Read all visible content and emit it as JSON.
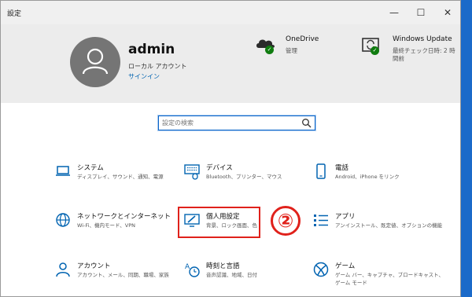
{
  "window": {
    "title": "設定"
  },
  "controls": {
    "minimize": "—",
    "maximize": "☐",
    "close": "✕"
  },
  "profile": {
    "name": "admin",
    "account_type": "ローカル アカウント",
    "sign_in": "サインイン"
  },
  "onedrive": {
    "name": "OneDrive",
    "status": "管理"
  },
  "windows_update": {
    "name": "Windows Update",
    "status_line1": "最終チェック日時: 2 時",
    "status_line2": "間前"
  },
  "search": {
    "placeholder": "設定の検索"
  },
  "tiles": [
    {
      "icon": "laptop-icon",
      "title": "システム",
      "desc": "ディスプレイ、サウンド、通知、電源"
    },
    {
      "icon": "keyboard-icon",
      "title": "デバイス",
      "desc": "Bluetooth、プリンター、マウス"
    },
    {
      "icon": "phone-icon",
      "title": "電話",
      "desc": "Android、iPhone をリンク"
    },
    {
      "icon": "globe-icon",
      "title": "ネットワークとインターネット",
      "desc": "Wi-Fi、機内モード、VPN"
    },
    {
      "icon": "personalization-icon",
      "title": "個人用設定",
      "desc": "背景、ロック画面、色"
    },
    {
      "icon": "apps-icon",
      "title": "アプリ",
      "desc": "アンインストール、既定値、オプションの機能"
    },
    {
      "icon": "person-icon",
      "title": "アカウント",
      "desc": "アカウント、メール、同期、職場、家族"
    },
    {
      "icon": "time-language-icon",
      "title": "時刻と言語",
      "desc": "音声認識、地域、日付"
    },
    {
      "icon": "xbox-icon",
      "title": "ゲーム",
      "desc": "ゲーム バー、キャプチャ、ブロードキャスト、ゲーム モード"
    }
  ],
  "annotation": {
    "number": "②"
  },
  "colors": {
    "accent": "#0063b1",
    "highlight": "#e0211b",
    "check": "#107c10",
    "header_bg": "#ececec"
  }
}
